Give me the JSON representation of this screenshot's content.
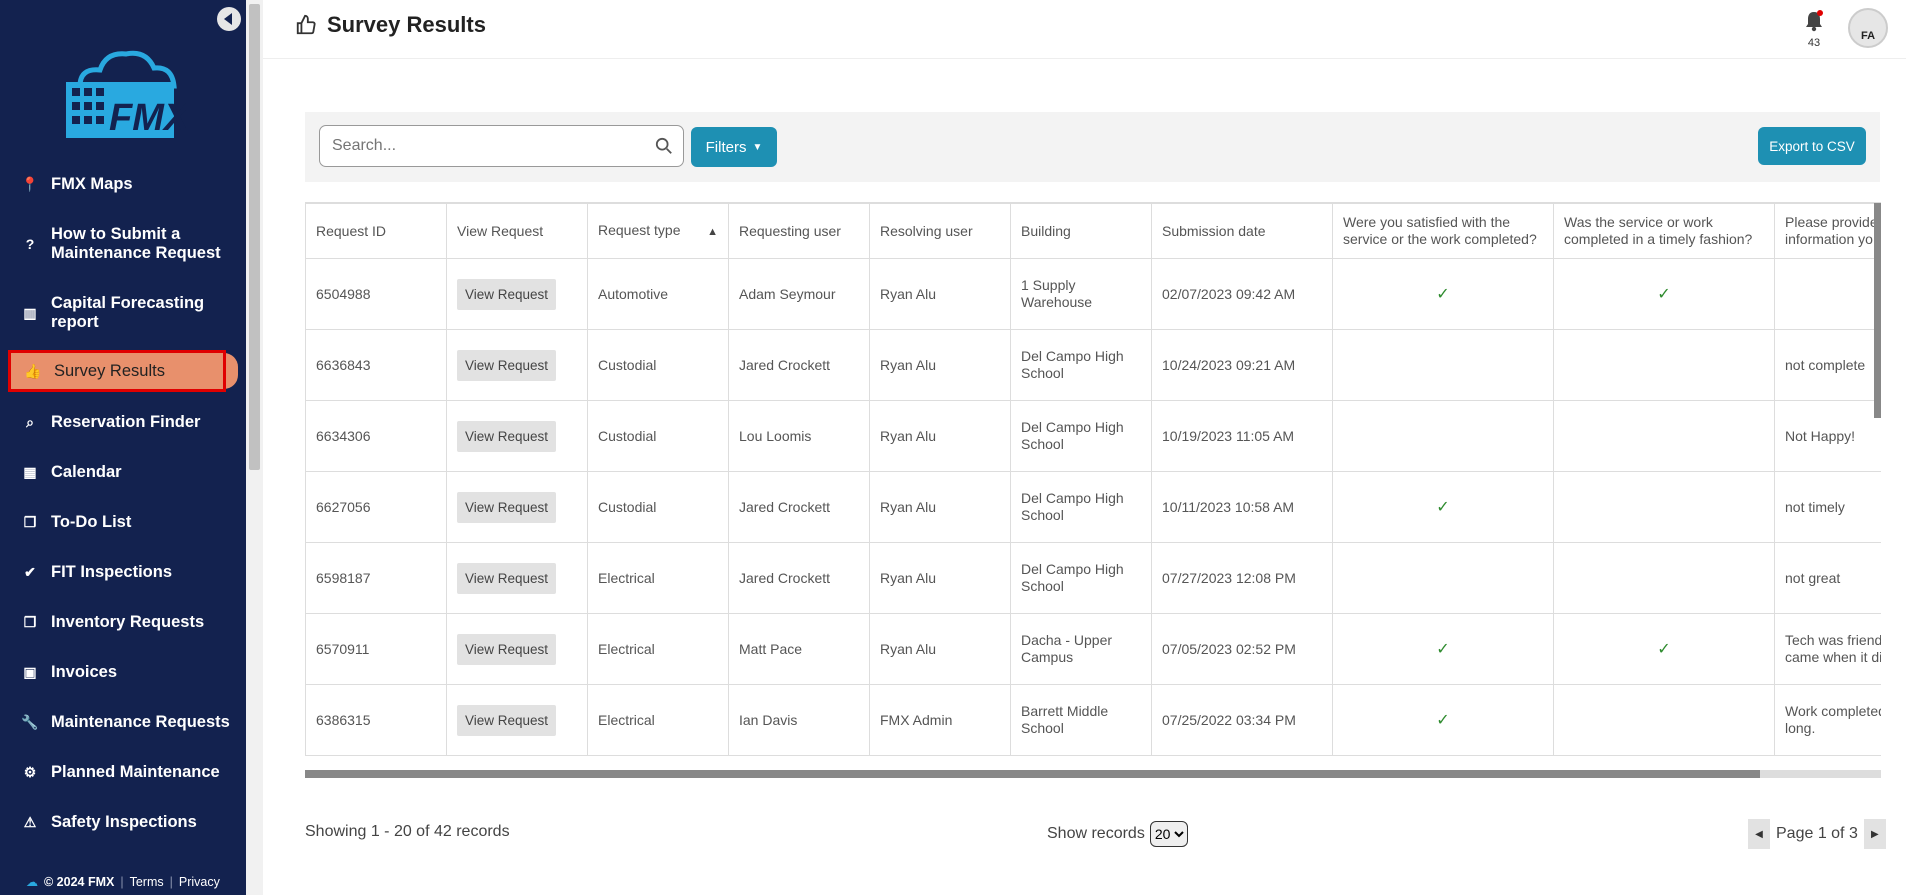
{
  "sidebar": {
    "logo_text": "FMX",
    "items": [
      {
        "label": "FMX Maps",
        "icon": "map-pin-icon",
        "glyph": "📍"
      },
      {
        "label": "How to Submit a Maintenance Request",
        "icon": "help-circle-icon",
        "glyph": "?"
      },
      {
        "label": "Capital Forecasting report",
        "icon": "bar-chart-icon",
        "glyph": "▥"
      },
      {
        "label": "Survey Results",
        "icon": "thumbs-up-icon",
        "glyph": "👍"
      },
      {
        "label": "Reservation Finder",
        "icon": "search-icon",
        "glyph": "⌕"
      },
      {
        "label": "Calendar",
        "icon": "calendar-icon",
        "glyph": "▦"
      },
      {
        "label": "To-Do List",
        "icon": "copy-icon",
        "glyph": "❐"
      },
      {
        "label": "FIT Inspections",
        "icon": "check-icon",
        "glyph": "✔"
      },
      {
        "label": "Inventory Requests",
        "icon": "copy-icon",
        "glyph": "❐"
      },
      {
        "label": "Invoices",
        "icon": "money-icon",
        "glyph": "▣"
      },
      {
        "label": "Maintenance Requests",
        "icon": "wrench-icon",
        "glyph": "🔧"
      },
      {
        "label": "Planned Maintenance",
        "icon": "cogs-icon",
        "glyph": "⚙"
      },
      {
        "label": "Safety Inspections",
        "icon": "warning-icon",
        "glyph": "⚠"
      }
    ],
    "footer": {
      "copyright": "© 2024 FMX",
      "terms": "Terms",
      "privacy": "Privacy"
    }
  },
  "header": {
    "title": "Survey Results",
    "notification_count": "43",
    "avatar_initials": "FA"
  },
  "toolbar": {
    "search_placeholder": "Search...",
    "filters_label": "Filters",
    "export_label": "Export to CSV"
  },
  "table": {
    "columns": [
      "Request ID",
      "View Request",
      "Request type",
      "Requesting user",
      "Resolving user",
      "Building",
      "Submission date",
      "Were you satisfied with the service or the work completed?",
      "Was the service or work completed in a timely fashion?",
      "Please provide any additional information yo"
    ],
    "sorted_column": "Request type",
    "view_button_label": "View Request",
    "rows": [
      {
        "id": "6504988",
        "type": "Automotive",
        "requester": "Adam Seymour",
        "resolver": "Ryan Alu",
        "building": "1 Supply Warehouse",
        "date": "02/07/2023 09:42 AM",
        "satisfied": "✓",
        "timely": "✓",
        "comment": ""
      },
      {
        "id": "6636843",
        "type": "Custodial",
        "requester": "Jared Crockett",
        "resolver": "Ryan Alu",
        "building": "Del Campo High School",
        "date": "10/24/2023 09:21 AM",
        "satisfied": "",
        "timely": "",
        "comment": "not complete"
      },
      {
        "id": "6634306",
        "type": "Custodial",
        "requester": "Lou Loomis",
        "resolver": "Ryan Alu",
        "building": "Del Campo High School",
        "date": "10/19/2023 11:05 AM",
        "satisfied": "",
        "timely": "",
        "comment": "Not Happy!"
      },
      {
        "id": "6627056",
        "type": "Custodial",
        "requester": "Jared Crockett",
        "resolver": "Ryan Alu",
        "building": "Del Campo High School",
        "date": "10/11/2023 10:58 AM",
        "satisfied": "✓",
        "timely": "",
        "comment": "not timely"
      },
      {
        "id": "6598187",
        "type": "Electrical",
        "requester": "Jared Crockett",
        "resolver": "Ryan Alu",
        "building": "Del Campo High School",
        "date": "07/27/2023 12:08 PM",
        "satisfied": "",
        "timely": "",
        "comment": "not great"
      },
      {
        "id": "6570911",
        "type": "Electrical",
        "requester": "Matt Pace",
        "resolver": "Ryan Alu",
        "building": "Dacha - Upper Campus",
        "date": "07/05/2023 02:52 PM",
        "satisfied": "✓",
        "timely": "✓",
        "comment": "Tech was friendly, made sure he came when it didn't disturb"
      },
      {
        "id": "6386315",
        "type": "Electrical",
        "requester": "Ian Davis",
        "resolver": "FMX Admin",
        "building": "Barrett Middle School",
        "date": "07/25/2022 03:34 PM",
        "satisfied": "✓",
        "timely": "",
        "comment": "Work completed but took too long."
      }
    ]
  },
  "footer": {
    "records_info": "Showing 1 - 20 of 42 records",
    "show_records_label": "Show records",
    "show_records_value": "20",
    "page_info": "Page 1 of 3"
  },
  "colors": {
    "sidebar_bg": "#13224f",
    "active_item": "#e8906c",
    "accent": "#1e90b3",
    "check": "#2e8b2e"
  }
}
